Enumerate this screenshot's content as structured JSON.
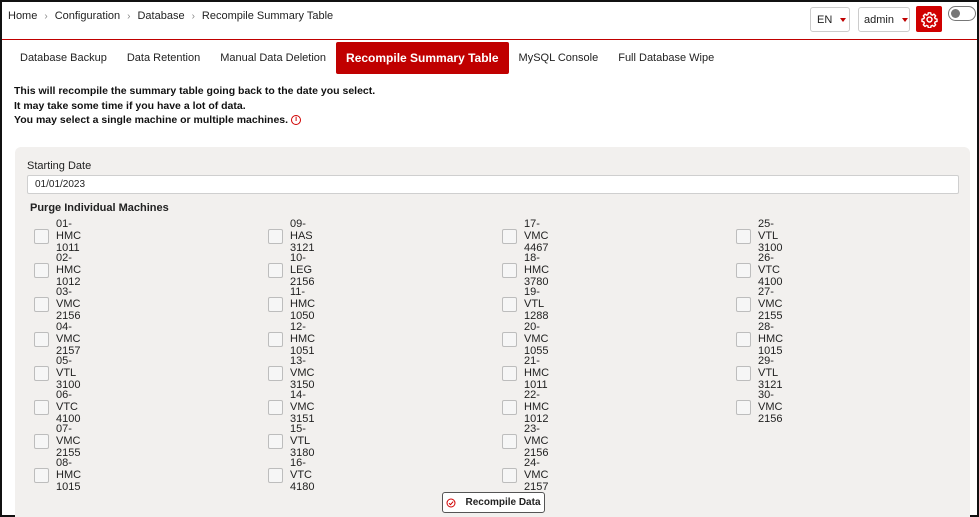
{
  "breadcrumb": [
    "Home",
    "Configuration",
    "Database",
    "Recompile Summary Table"
  ],
  "header": {
    "language": "EN",
    "user": "admin",
    "gear_icon": "gear-icon",
    "toggle_state": "off"
  },
  "tabs": [
    {
      "label": "Database Backup",
      "active": false
    },
    {
      "label": "Data Retention",
      "active": false
    },
    {
      "label": "Manual Data Deletion",
      "active": false
    },
    {
      "label": "Recompile Summary Table",
      "active": true
    },
    {
      "label": "MySQL Console",
      "active": false
    },
    {
      "label": "Full Database Wipe",
      "active": false
    }
  ],
  "intro": {
    "line1": "This will recompile the summary table going back to the date you select.",
    "line2": "It may take some time if you have a lot of data.",
    "line3": "You may select a single machine or multiple machines.",
    "info_icon": "info-icon"
  },
  "form": {
    "date_label": "Starting Date",
    "date_value": "01/01/2023",
    "purge_title": "Purge Individual Machines",
    "submit_label": "Recompile Data"
  },
  "machines": [
    [
      "01-HMC 1011",
      "02-HMC 1012",
      "03-VMC 2156",
      "04-VMC 2157",
      "05-VTL 3100",
      "06-VTC 4100",
      "07-VMC 2155",
      "08-HMC 1015"
    ],
    [
      "09-HAS 3121",
      "10-LEG 2156",
      "11-HMC 1050",
      "12-HMC 1051",
      "13-VMC 3150",
      "14-VMC 3151",
      "15-VTL 3180",
      "16-VTC 4180"
    ],
    [
      "17-VMC 4467",
      "18-HMC 3780",
      "19-VTL 1288",
      "20-VMC 1055",
      "21-HMC 1011",
      "22-HMC 1012",
      "23-VMC 2156",
      "24-VMC 2157"
    ],
    [
      "25-VTL 3100",
      "26-VTC 4100",
      "27-VMC 2155",
      "28-HMC 1015",
      "29-VTL 3121",
      "30-VMC 2156"
    ]
  ],
  "colors": {
    "accent": "#c00000",
    "panel_bg": "#f2f0ee"
  }
}
